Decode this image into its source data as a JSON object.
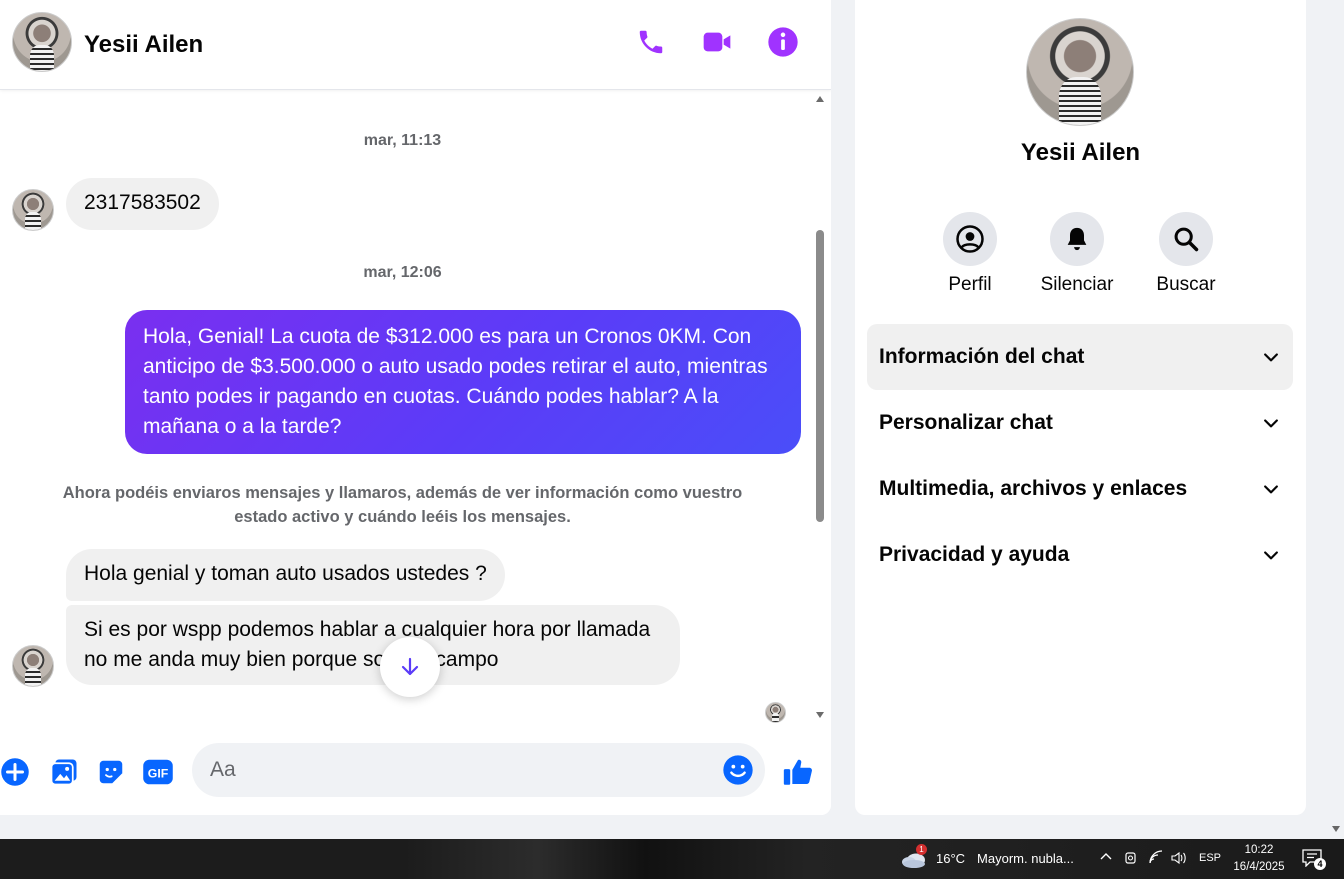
{
  "header": {
    "contact_name": "Yesii Ailen",
    "icons": [
      "phone-icon",
      "video-icon",
      "info-icon"
    ],
    "accent_color": "#a033ff"
  },
  "messages": {
    "timestamp_1": "mar, 11:13",
    "msg_1": "2317583502",
    "timestamp_2": "mar, 12:06",
    "msg_2": "Hola, Genial! La cuota de $312.000 es para un Cronos 0KM. Con anticipo de $3.500.000 o auto usado podes retirar el auto, mientras tanto podes ir pagando en cuotas. Cuándo podes hablar? A la mañana o a la tarde?",
    "system_note": "Ahora podéis enviaros mensajes y llamaros, además de ver información como vuestro estado activo y cuándo leéis los mensajes.",
    "msg_3": "Hola genial y toman auto usados ustedes ?",
    "msg_4": "Si es por wspp podemos hablar a cualquier hora por llamada no me anda muy bien porque soy del campo"
  },
  "composer": {
    "placeholder": "Aa",
    "icons": [
      "plus-icon",
      "image-icon",
      "sticker-icon",
      "gif-icon",
      "emoji-icon",
      "like-icon"
    ],
    "gif_label": "GIF",
    "accent_color": "#0866ff"
  },
  "info_panel": {
    "name": "Yesii Ailen",
    "actions": [
      {
        "label": "Perfil",
        "icon": "profile-icon"
      },
      {
        "label": "Silenciar",
        "icon": "bell-icon"
      },
      {
        "label": "Buscar",
        "icon": "search-icon"
      }
    ],
    "sections": [
      {
        "title": "Información del chat"
      },
      {
        "title": "Personalizar chat"
      },
      {
        "title": "Multimedia, archivos y enlaces"
      },
      {
        "title": "Privacidad y ayuda"
      }
    ]
  },
  "taskbar": {
    "weather_temp": "16°C",
    "weather_text": "Mayorm. nubla...",
    "weather_badge": "1",
    "language": "ESP",
    "time": "10:22",
    "date": "16/4/2025",
    "notifications": "4"
  }
}
